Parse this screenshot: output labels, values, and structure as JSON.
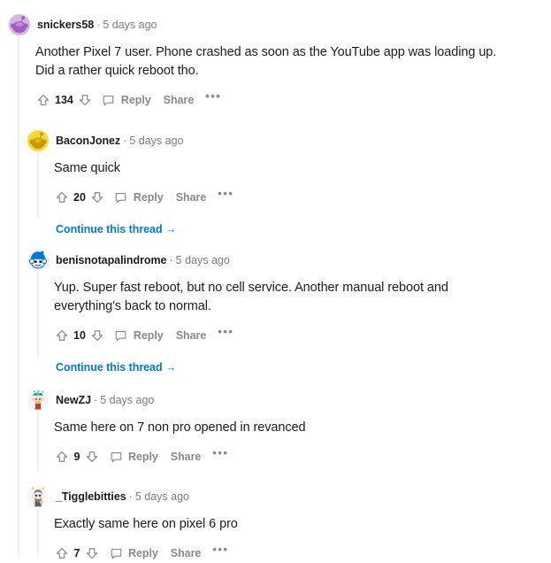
{
  "site": "reddit-comment-thread",
  "labels": {
    "reply": "Reply",
    "share": "Share",
    "more": "•••",
    "continue": "Continue this thread →",
    "separator": "·"
  },
  "colors": {
    "link": "#0079d3",
    "text": "#1c1c1c",
    "muted": "#7c7c7c",
    "action": "#878a8c",
    "threadline": "#edeff1"
  },
  "comments": [
    {
      "id": "c1",
      "username": "snickers58",
      "age": "5 days ago",
      "body_lines": [
        "Another Pixel 7 user. Phone crashed as soon as the YouTube app was loading up.",
        "Did a rather quick reboot tho."
      ],
      "score": "134",
      "avatar": "snoo-purple",
      "depth": 0,
      "continue_thread": false
    },
    {
      "id": "c2",
      "username": "BaconJonez",
      "age": "5 days ago",
      "body_lines": [
        "Same quick"
      ],
      "score": "20",
      "avatar": "snoo-gold",
      "depth": 1,
      "continue_thread": true
    },
    {
      "id": "c3",
      "username": "benisnotapalindrome",
      "age": "5 days ago",
      "body_lines": [
        "Yup. Super fast reboot, but no cell service. Another manual reboot and",
        "everything's back to normal."
      ],
      "score": "10",
      "avatar": "snoo-blue",
      "depth": 1,
      "continue_thread": true
    },
    {
      "id": "c4",
      "username": "NewZJ",
      "age": "5 days ago",
      "body_lines": [
        "Same here on 7 non pro opened in revanced"
      ],
      "score": "9",
      "avatar": "snoo-dragonhat",
      "depth": 1,
      "continue_thread": false
    },
    {
      "id": "c5",
      "username": "_Tigglebitties",
      "age": "5 days ago",
      "body_lines": [
        "Exactly same here on pixel 6 pro"
      ],
      "score": "7",
      "avatar": "snoo-beard",
      "depth": 1,
      "continue_thread": false
    }
  ]
}
